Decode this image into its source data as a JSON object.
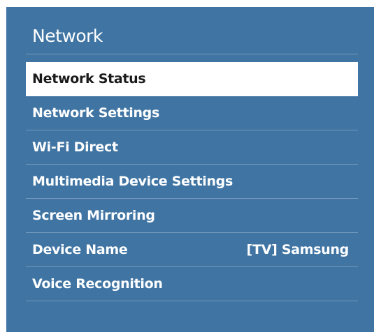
{
  "colors": {
    "panel_background": "#3f74a3",
    "selected_background": "#ffffff",
    "selected_text": "#1a1a1a",
    "text": "#ffffff"
  },
  "menu": {
    "title": "Network",
    "items": [
      {
        "label": "Network Status",
        "selected": true
      },
      {
        "label": "Network Settings",
        "selected": false
      },
      {
        "label": "Wi-Fi Direct",
        "selected": false
      },
      {
        "label": "Multimedia Device Settings",
        "selected": false
      },
      {
        "label": "Screen Mirroring",
        "selected": false
      },
      {
        "label": "Device Name",
        "value": "[TV] Samsung",
        "selected": false
      },
      {
        "label": "Voice Recognition",
        "selected": false
      }
    ]
  }
}
